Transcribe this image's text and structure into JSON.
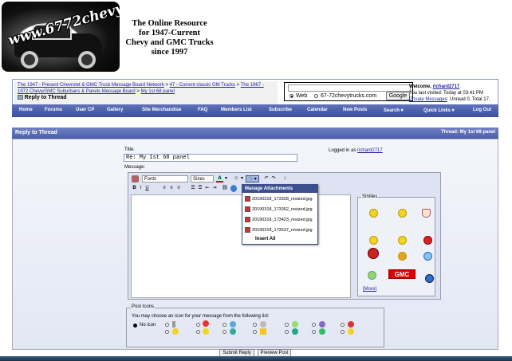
{
  "site": {
    "logo_text": "www.6772chevytrucks.com",
    "tagline": [
      "The Online Resource",
      "for 1947-Current",
      "Chevy and GMC Trucks",
      "since 1997"
    ]
  },
  "breadcrumb": {
    "links": [
      "The 1947 - Present Chevrolet & GMC Truck Message Board Network",
      "47 - Current classic GM Trucks",
      "The 1967 - 1972 Chevy/GMC Suburbans & Panels Message Board",
      "My 1st 68 panel"
    ],
    "current": "Reply to Thread"
  },
  "search": {
    "opt_web": "Web",
    "opt_site": "67-72chevytrucks.com",
    "button": "Google"
  },
  "welcome": {
    "greeting": "Welcome,",
    "user": "richard2717",
    "last_visit": "You last visited: Today at 03:41 PM",
    "pm_link": "Private Messages",
    "pm_stats": ": Unread 0, Total 17."
  },
  "nav": [
    "Home",
    "Forums",
    "User CP",
    "Gallery",
    "Site Merchandise",
    "FAQ",
    "Members List",
    "Subscribe",
    "Calendar",
    "New Posts",
    "Search ▾",
    "Quick Links ▾",
    "Log Out"
  ],
  "panel": {
    "title": "Reply to Thread",
    "thread_label": "Thread: My 1st 68 panel"
  },
  "form": {
    "title_label": "Title:",
    "title_value": "Re: My 1st 68 panel",
    "logged_in_label": "Logged in as",
    "logged_in_user": "richard2717",
    "message_label": "Message:",
    "font_select": "Fonts",
    "size_select": "Sizes",
    "text_color": "A",
    "bold": "B",
    "italic": "I",
    "underline": "U"
  },
  "attachments": {
    "header": "Manage Attachments",
    "files": [
      "20190318_173328_resized.jpg",
      "20190318_173352_resized.jpg",
      "20190318_173423_resized.jpg",
      "20190318_173537_resized.jpg"
    ],
    "insert_all": "Insert All"
  },
  "smilies": {
    "legend": "Smilies",
    "more": "[More]",
    "badge": "GMC"
  },
  "post_icons": {
    "legend": "Post Icons",
    "hint": "You may choose an icon for your message from the following list:",
    "no_icon": "No icon"
  },
  "buttons": {
    "submit": "Submit Reply",
    "preview": "Preview Post"
  },
  "colors": {
    "nav_bg": "#3a4f9c",
    "panel_header": "#4b5ea9",
    "link": "#22229c"
  }
}
